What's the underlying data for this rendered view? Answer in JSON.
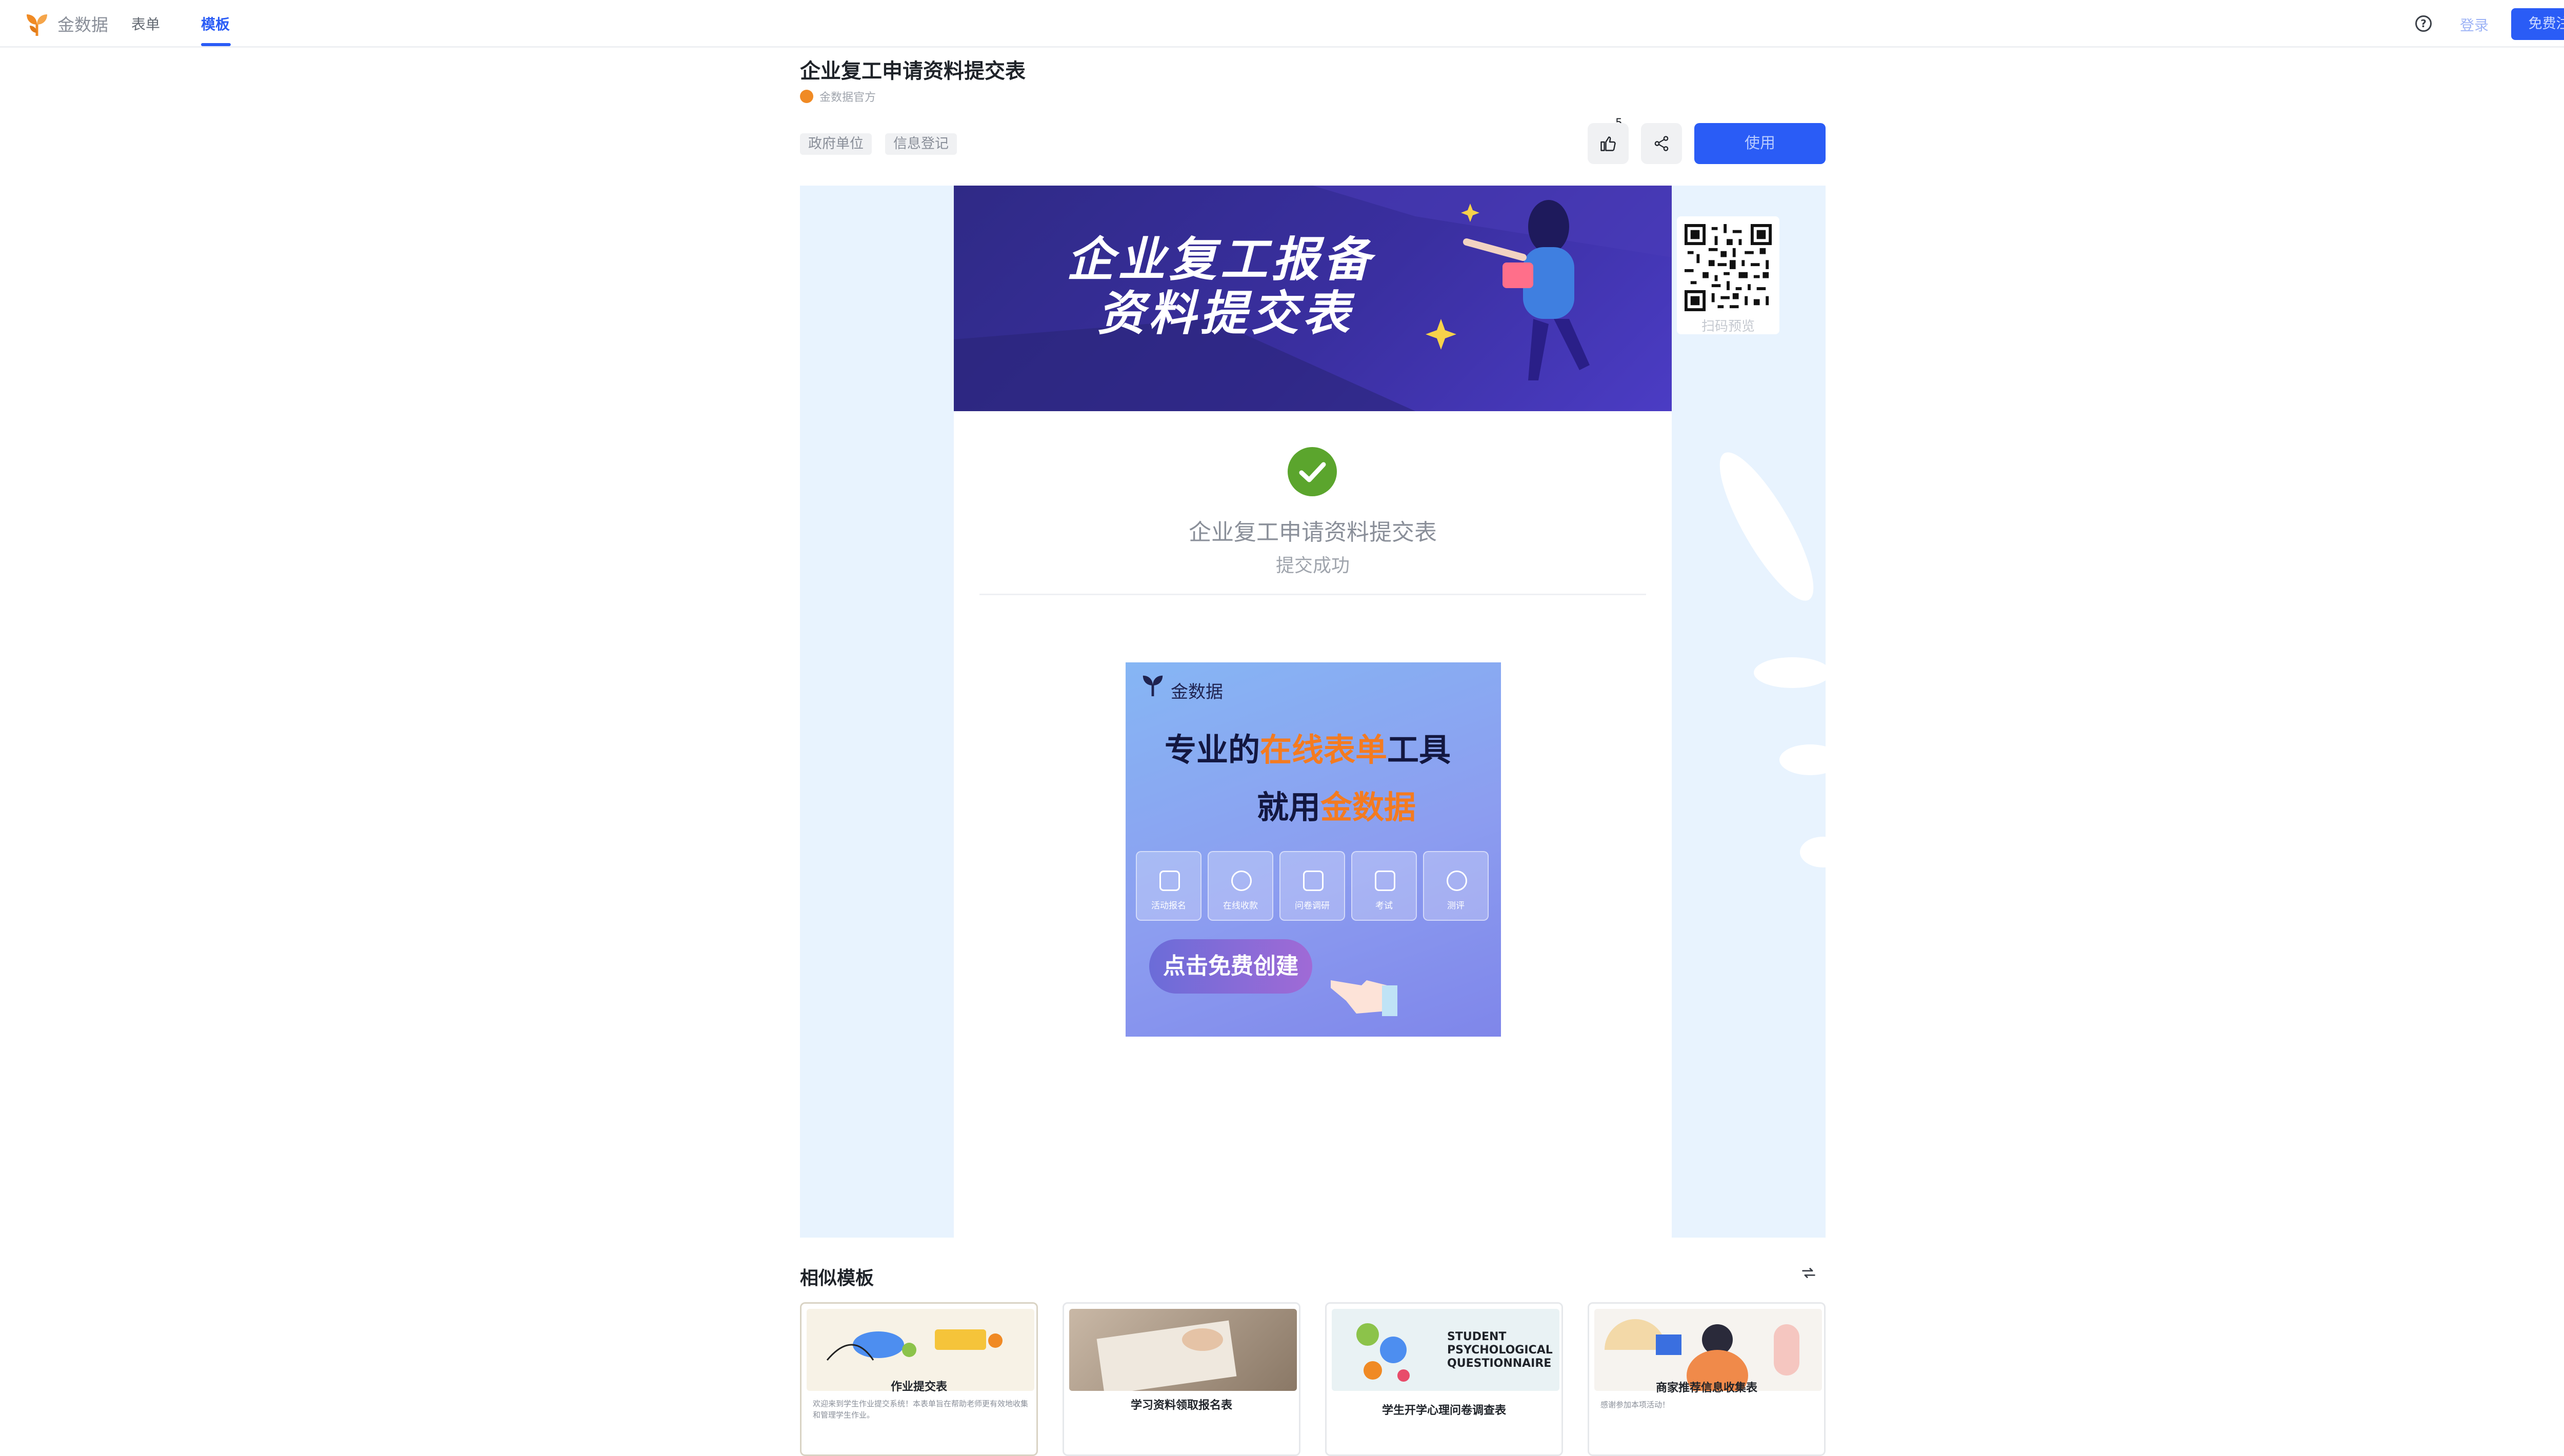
{
  "header": {
    "brand": "金数据",
    "nav": [
      {
        "label": "表单",
        "active": false
      },
      {
        "label": "模板",
        "active": true
      }
    ],
    "login": "登录",
    "register": "免费注册",
    "accent": "#2a5cf6"
  },
  "template": {
    "title": "企业复工申请资料提交表",
    "author": "金数据官方",
    "tags": [
      "政府单位",
      "信息登记"
    ],
    "likes": "5",
    "use_label": "使用"
  },
  "preview": {
    "banner_line1": "企业复工报备",
    "banner_line2": "资料提交表",
    "success_title": "企业复工申请资料提交表",
    "success_sub": "提交成功",
    "qr_label": "扫码预览",
    "ad": {
      "brand": "金数据",
      "line1_a": "专业的",
      "line1_b": "在线表单",
      "line1_c": "工具",
      "line2_a": "就用",
      "line2_b": "金数据",
      "features": [
        "活动报名",
        "在线收款",
        "问卷调研",
        "考试",
        "测评"
      ],
      "cta": "点击免费创建"
    }
  },
  "similar": {
    "title": "相似模板",
    "cards": [
      {
        "name": "作业提交表",
        "desc": "欢迎来到学生作业提交系统！本表单旨在帮助老师更有效地收集和管理学生作业。"
      },
      {
        "name": "学习资料领取报名表",
        "desc": ""
      },
      {
        "name": "学生开学心理问卷调查表",
        "thumb_text": "STUDENT PSYCHOLOGICAL QUESTIONNAIRE",
        "desc": ""
      },
      {
        "name": "商家推荐信息收集表",
        "desc": "感谢参加本项活动！"
      }
    ]
  }
}
